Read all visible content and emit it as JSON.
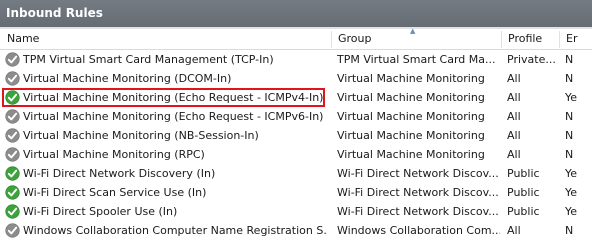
{
  "panel": {
    "title": "Inbound Rules"
  },
  "columns": {
    "name": "Name",
    "group": "Group",
    "profile": "Profile",
    "enabled": "Er"
  },
  "colors": {
    "enabled_icon": "#3aa33a",
    "disabled_icon": "#8c8c8c",
    "highlight": "#e0141a"
  },
  "rules": [
    {
      "name": "TPM Virtual Smart Card Management (TCP-In)",
      "group": "TPM Virtual Smart Card Ma...",
      "profile": "Private...",
      "enabled": "N",
      "status_icon": "disabled-check-icon"
    },
    {
      "name": "Virtual Machine Monitoring (DCOM-In)",
      "group": "Virtual Machine Monitoring",
      "profile": "All",
      "enabled": "N",
      "status_icon": "disabled-check-icon"
    },
    {
      "name": "Virtual Machine Monitoring (Echo Request - ICMPv4-In)",
      "group": "Virtual Machine Monitoring",
      "profile": "All",
      "enabled": "Ye",
      "status_icon": "enabled-check-icon",
      "highlighted": true
    },
    {
      "name": "Virtual Machine Monitoring (Echo Request - ICMPv6-In)",
      "group": "Virtual Machine Monitoring",
      "profile": "All",
      "enabled": "N",
      "status_icon": "disabled-check-icon"
    },
    {
      "name": "Virtual Machine Monitoring (NB-Session-In)",
      "group": "Virtual Machine Monitoring",
      "profile": "All",
      "enabled": "N",
      "status_icon": "disabled-check-icon"
    },
    {
      "name": "Virtual Machine Monitoring (RPC)",
      "group": "Virtual Machine Monitoring",
      "profile": "All",
      "enabled": "N",
      "status_icon": "disabled-check-icon"
    },
    {
      "name": "Wi-Fi Direct Network Discovery (In)",
      "group": "Wi-Fi Direct Network Discov...",
      "profile": "Public",
      "enabled": "Ye",
      "status_icon": "enabled-check-icon"
    },
    {
      "name": "Wi-Fi Direct Scan Service Use (In)",
      "group": "Wi-Fi Direct Network Discov...",
      "profile": "Public",
      "enabled": "Ye",
      "status_icon": "enabled-check-icon"
    },
    {
      "name": "Wi-Fi Direct Spooler Use (In)",
      "group": "Wi-Fi Direct Network Discov...",
      "profile": "Public",
      "enabled": "Ye",
      "status_icon": "enabled-check-icon"
    },
    {
      "name": "Windows Collaboration Computer Name Registration S...",
      "group": "Windows Collaboration Com...",
      "profile": "All",
      "enabled": "N",
      "status_icon": "disabled-check-icon"
    }
  ]
}
